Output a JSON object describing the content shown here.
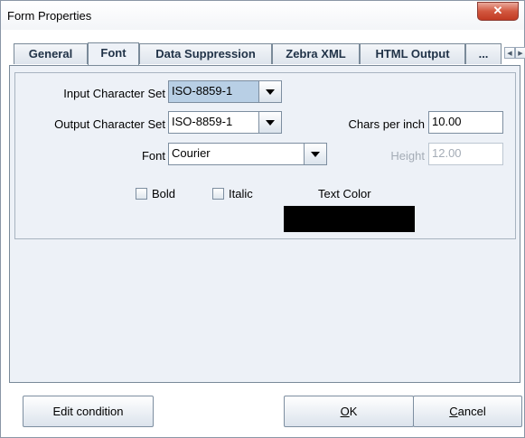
{
  "window": {
    "title": "Form Properties",
    "close_glyph": "✕"
  },
  "tabs": [
    {
      "label": "General"
    },
    {
      "label": "Font"
    },
    {
      "label": "Data Suppression"
    },
    {
      "label": "Zebra XML"
    },
    {
      "label": "HTML Output"
    },
    {
      "label": "..."
    }
  ],
  "tab_scroll": {
    "left_glyph": "◀",
    "right_glyph": "▶"
  },
  "font_tab": {
    "input_charset": {
      "label": "Input Character Set",
      "value": "ISO-8859-1"
    },
    "output_charset": {
      "label": "Output Character Set",
      "value": "ISO-8859-1"
    },
    "chars_per_inch": {
      "label": "Chars per inch",
      "value": "10.00"
    },
    "font": {
      "label": "Font",
      "value": "Courier"
    },
    "height": {
      "label": "Height",
      "value": "12.00"
    },
    "bold": {
      "label": "Bold",
      "checked": false
    },
    "italic": {
      "label": "Italic",
      "checked": false
    },
    "text_color": {
      "label": "Text Color",
      "color": "#000000"
    }
  },
  "buttons": {
    "edit_condition": "Edit condition",
    "ok_mnemonic": "O",
    "ok_rest": "K",
    "cancel_mnemonic": "C",
    "cancel_rest": "ancel"
  }
}
